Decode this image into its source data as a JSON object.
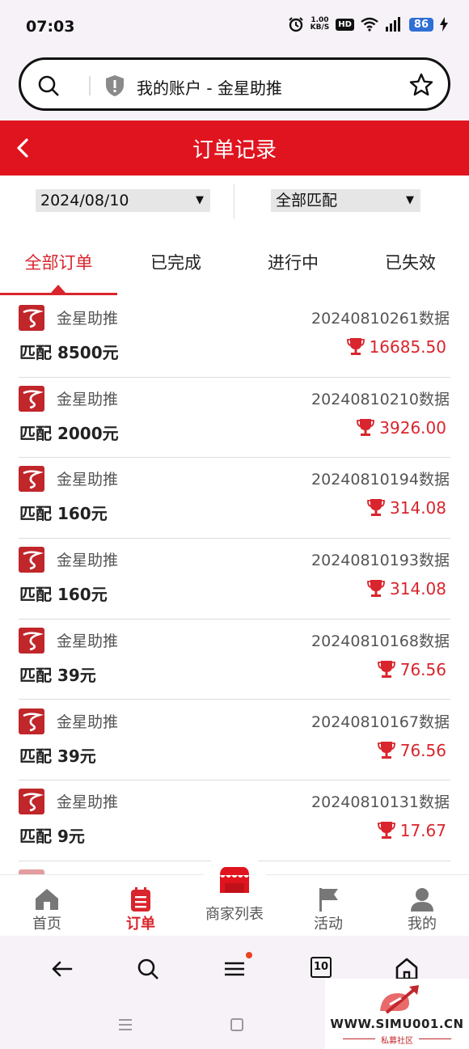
{
  "status_bar": {
    "time": "07:03",
    "net_speed_value": "1.00",
    "net_speed_unit": "KB/S",
    "hd_label": "HD",
    "battery": "86"
  },
  "browser": {
    "page_title": "我的账户 - 金星助推"
  },
  "header": {
    "title": "订单记录"
  },
  "filters": {
    "date_value": "2024/08/10",
    "match_value": "全部匹配"
  },
  "tabs": [
    {
      "label": "全部订单",
      "active": true
    },
    {
      "label": "已完成",
      "active": false
    },
    {
      "label": "进行中",
      "active": false
    },
    {
      "label": "已失效",
      "active": false
    }
  ],
  "orders": [
    {
      "merchant": "金星助推",
      "order_no": "20240810261数据",
      "match": "匹配 8500元",
      "reward": "16685.50"
    },
    {
      "merchant": "金星助推",
      "order_no": "20240810210数据",
      "match": "匹配 2000元",
      "reward": "3926.00"
    },
    {
      "merchant": "金星助推",
      "order_no": "20240810194数据",
      "match": "匹配 160元",
      "reward": "314.08"
    },
    {
      "merchant": "金星助推",
      "order_no": "20240810193数据",
      "match": "匹配 160元",
      "reward": "314.08"
    },
    {
      "merchant": "金星助推",
      "order_no": "20240810168数据",
      "match": "匹配 39元",
      "reward": "76.56"
    },
    {
      "merchant": "金星助推",
      "order_no": "20240810167数据",
      "match": "匹配 39元",
      "reward": "76.56"
    },
    {
      "merchant": "金星助推",
      "order_no": "20240810131数据",
      "match": "匹配 9元",
      "reward": "17.67"
    }
  ],
  "bottom_nav": {
    "home": "首页",
    "orders": "订单",
    "merchants": "商家列表",
    "activity": "活动",
    "mine": "我的"
  },
  "browser_toolbar": {
    "tab_count": "10"
  },
  "watermark": {
    "url": "WWW.SIMU001.CN",
    "sub": "私募社区"
  },
  "colors": {
    "brand_red": "#e0141e",
    "accent_red": "#d9252d"
  }
}
